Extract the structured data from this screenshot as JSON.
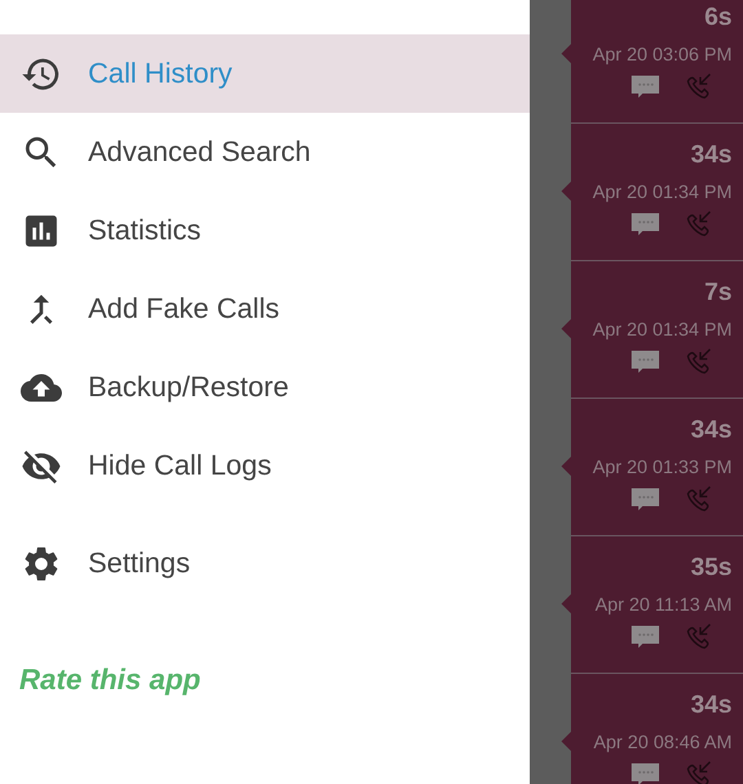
{
  "drawer": {
    "items": [
      {
        "label": "Call History",
        "selected": true
      },
      {
        "label": "Advanced Search",
        "selected": false
      },
      {
        "label": "Statistics",
        "selected": false
      },
      {
        "label": "Add Fake Calls",
        "selected": false
      },
      {
        "label": "Backup/Restore",
        "selected": false
      },
      {
        "label": "Hide Call Logs",
        "selected": false
      }
    ],
    "secondary_items": [
      {
        "label": "Settings",
        "selected": false
      }
    ],
    "rate_link": "Rate this app"
  },
  "calls": [
    {
      "duration": "6s",
      "time": "Apr 20 03:06 PM"
    },
    {
      "duration": "34s",
      "time": "Apr 20 01:34 PM"
    },
    {
      "duration": "7s",
      "time": "Apr 20 01:34 PM"
    },
    {
      "duration": "34s",
      "time": "Apr 20 01:33 PM"
    },
    {
      "duration": "35s",
      "time": "Apr 20 11:13 AM"
    },
    {
      "duration": "34s",
      "time": "Apr 20 08:46 AM"
    }
  ]
}
